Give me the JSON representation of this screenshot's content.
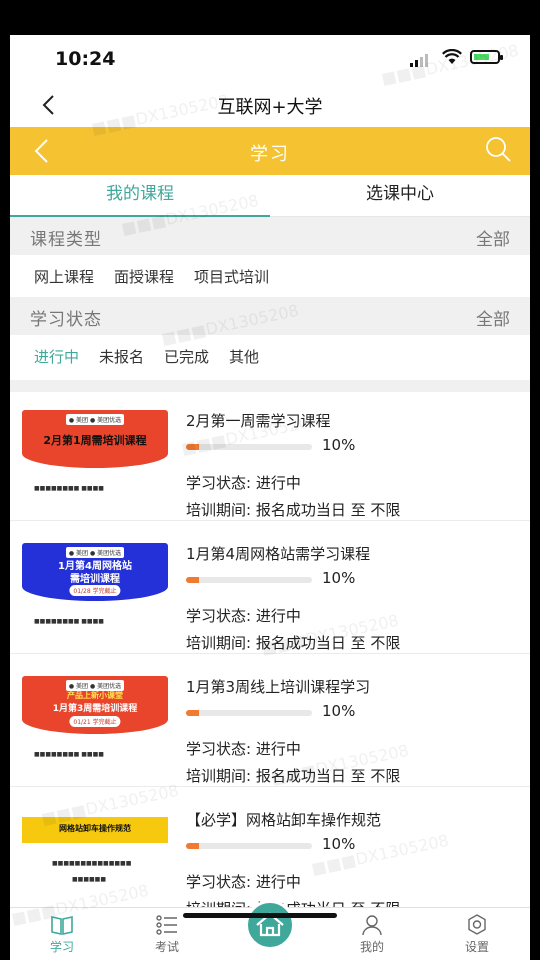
{
  "status_bar": {
    "time": "10:24"
  },
  "nav": {
    "title": "互联网+大学"
  },
  "header": {
    "title": "学习"
  },
  "tabs": [
    {
      "label": "我的课程",
      "active": true
    },
    {
      "label": "选课中心",
      "active": false
    }
  ],
  "course_type": {
    "label": "课程类型",
    "all": "全部",
    "options": [
      "网上课程",
      "面授课程",
      "项目式培训"
    ]
  },
  "study_status": {
    "label": "学习状态",
    "all": "全部",
    "options": [
      {
        "label": "进行中",
        "active": true
      },
      {
        "label": "未报名",
        "active": false
      },
      {
        "label": "已完成",
        "active": false
      },
      {
        "label": "其他",
        "active": false
      }
    ]
  },
  "courses": [
    {
      "title": "2月第一周需学习课程",
      "progress": 10,
      "progress_text": "10%",
      "status": "学习状态: 进行中",
      "period": "培训期间: 报名成功当日 至 不限",
      "thumb": {
        "text": "2月第1周需培训课程",
        "color": "#e8452c"
      }
    },
    {
      "title": "1月第4周网格站需学习课程",
      "progress": 10,
      "progress_text": "10%",
      "status": "学习状态: 进行中",
      "period": "培训期间: 报名成功当日 至 不限",
      "thumb": {
        "text": "1月第4周网格站",
        "text2": "需培训课程",
        "chip": "01/28 学完截止",
        "color": "#2430d8"
      }
    },
    {
      "title": "1月第3周线上培训课程学习",
      "progress": 10,
      "progress_text": "10%",
      "status": "学习状态: 进行中",
      "period": "培训期间: 报名成功当日 至 不限",
      "thumb": {
        "text": "产品上新小课堂",
        "text2": "1月第3周需培训课程",
        "chip": "01/21 学完截止",
        "color": "#e8452c"
      }
    },
    {
      "title": "【必学】网格站卸车操作规范",
      "progress": 10,
      "progress_text": "10%",
      "status": "学习状态: 进行中",
      "period": "培训期间: 报名成功当日 至 不限",
      "thumb": {
        "text": "网格站卸车操作规范",
        "color": "#f6c90e"
      }
    }
  ],
  "bottom_tabs": [
    {
      "label": "学习",
      "icon": "book-icon",
      "active": true
    },
    {
      "label": "考试",
      "icon": "list-icon",
      "active": false
    },
    {
      "label": "",
      "icon": "home-icon",
      "active": false
    },
    {
      "label": "我的",
      "icon": "user-icon",
      "active": false
    },
    {
      "label": "设置",
      "icon": "gear-icon",
      "active": false
    }
  ],
  "colors": {
    "accent": "#3fa89a",
    "header": "#f5c232",
    "progress": "#f07a30"
  }
}
